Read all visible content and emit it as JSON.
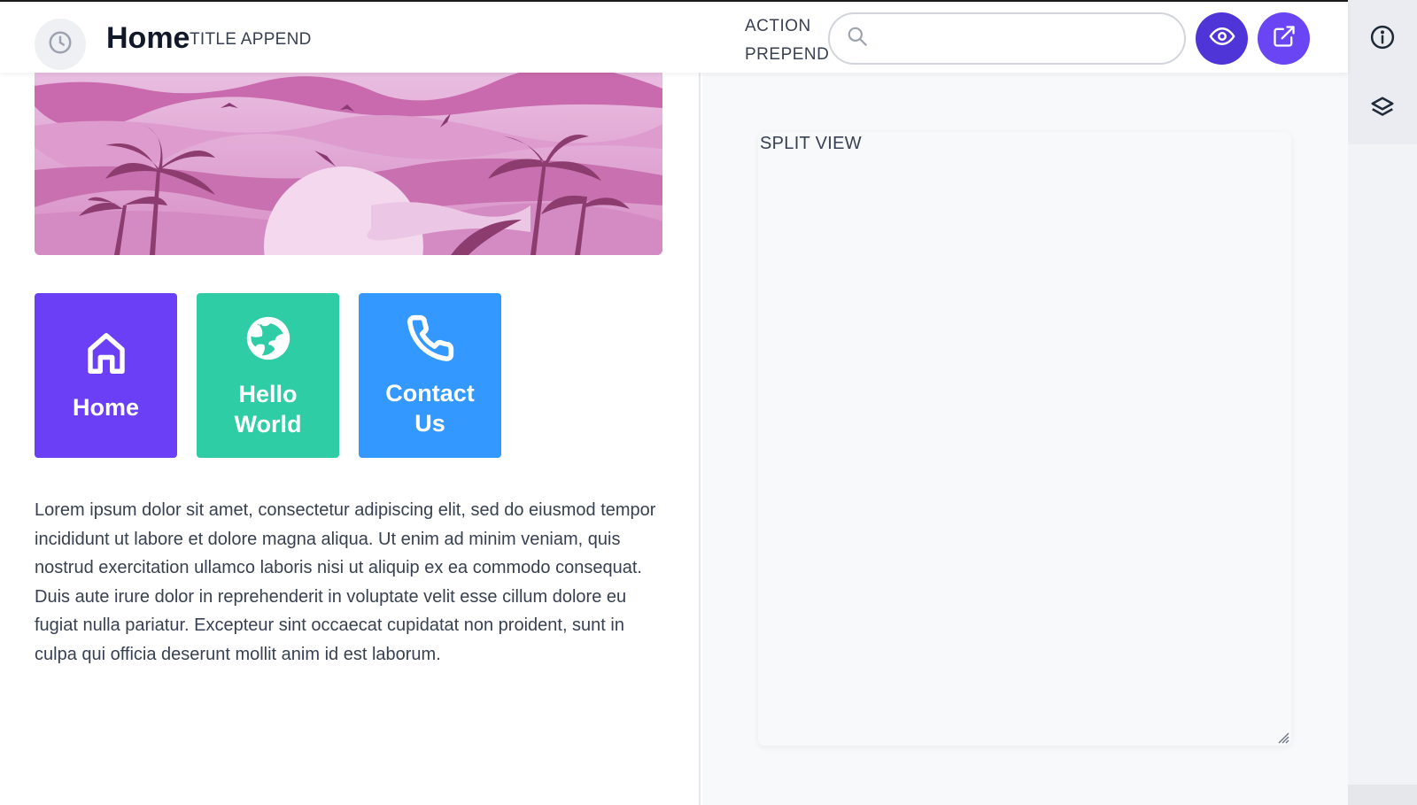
{
  "header": {
    "title": "Home",
    "title_append": "TITLE APPEND",
    "action_prepend_line1": "ACTION",
    "action_prepend_line2": "PREPEND",
    "search": {
      "value": "",
      "placeholder": ""
    },
    "icons": {
      "history": "clock-icon",
      "search": "search-icon",
      "preview": "eye-icon",
      "external": "external-link-icon"
    }
  },
  "rail": {
    "icons": [
      "info-icon",
      "layers-icon"
    ]
  },
  "tiles": [
    {
      "label": "Home",
      "icon": "house-icon",
      "color": "#6a3ff5"
    },
    {
      "label": "Hello World",
      "icon": "globe-icon",
      "color": "#2ecda5"
    },
    {
      "label": "Contact Us",
      "icon": "phone-icon",
      "color": "#3398ff"
    }
  ],
  "body_text": "Lorem ipsum dolor sit amet, consectetur adipiscing elit, sed do eiusmod tempor incididunt ut labore et dolore magna aliqua. Ut enim ad minim veniam, quis nostrud exercitation ullamco laboris nisi ut aliquip ex ea commodo consequat. Duis aute irure dolor in reprehenderit in voluptate velit esse cillum dolore eu fugiat nulla pariatur. Excepteur sint occaecat cupidatat non proident, sunt in culpa qui officia deserunt mollit anim id est laborum.",
  "split_view": {
    "label": "SPLIT VIEW"
  },
  "colors": {
    "primary_dark": "#4f35d8",
    "primary": "#6a45f3",
    "teal": "#2ecda5",
    "blue": "#3398ff",
    "banner_pink": "#e8b4dd"
  }
}
